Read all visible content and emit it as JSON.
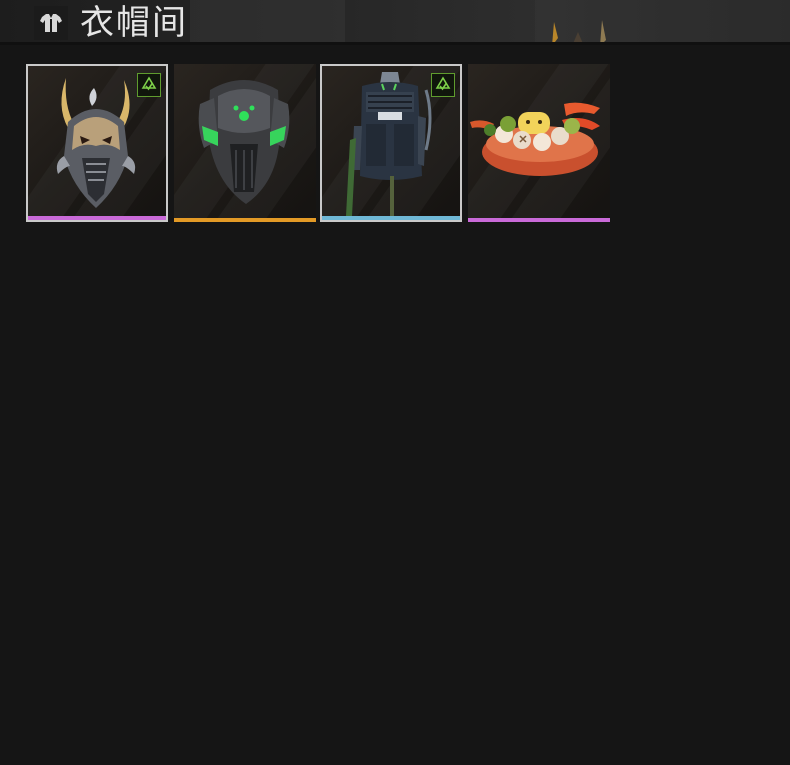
{
  "header": {
    "title": "衣帽间",
    "icon": "wardrobe-shirt-icon"
  },
  "items": [
    {
      "name": "dragon-mask",
      "icon": "horned-dragon-mask-icon",
      "rarity_color": "#c96ad8",
      "selected": true,
      "badge": "upgrade-badge-icon"
    },
    {
      "name": "green-armor-vest",
      "icon": "armor-vest-icon",
      "rarity_color": "#e39a26",
      "selected": false,
      "badge": null
    },
    {
      "name": "tactical-backpack",
      "icon": "backpack-icon",
      "rarity_color": "#6fb8d6",
      "selected": true,
      "badge": "upgrade-badge-icon"
    },
    {
      "name": "food-plate",
      "icon": "food-plate-icon",
      "rarity_color": "#c96ad8",
      "selected": false,
      "badge": null
    }
  ]
}
